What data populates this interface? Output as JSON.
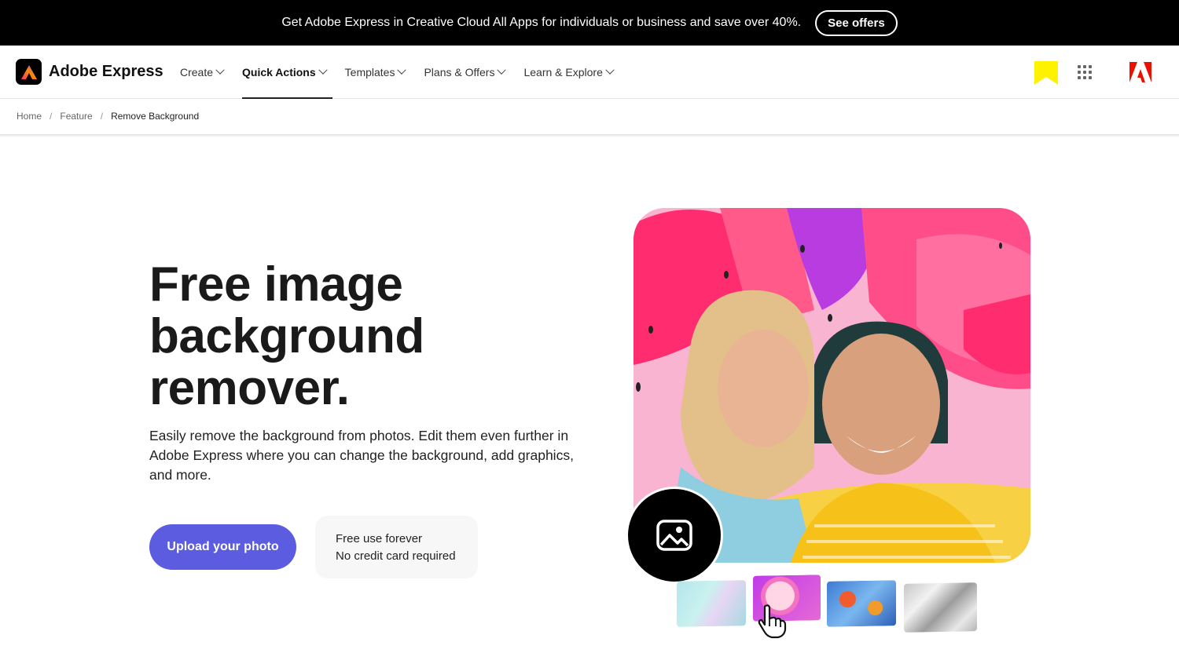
{
  "promo": {
    "text": "Get Adobe Express in Creative Cloud All Apps for individuals or business and save over 40%.",
    "button": "See offers"
  },
  "brand": {
    "name": "Adobe Express"
  },
  "nav": {
    "items": [
      {
        "label": "Create",
        "active": false
      },
      {
        "label": "Quick Actions",
        "active": true
      },
      {
        "label": "Templates",
        "active": false
      },
      {
        "label": "Plans & Offers",
        "active": false
      },
      {
        "label": "Learn & Explore",
        "active": false
      }
    ]
  },
  "icons": {
    "bookmark": "bookmark-icon",
    "apps": "apps-grid-icon",
    "adobe": "adobe-logo-icon",
    "image": "image-icon",
    "cursor": "hand-pointer-icon"
  },
  "breadcrumb": {
    "home": "Home",
    "sep": "/",
    "feature": "Feature",
    "current": "Remove Background"
  },
  "hero": {
    "title": "Free image background remover.",
    "description": "Easily remove the background from photos. Edit them even further in Adobe Express where you can change the background, add graphics, and more.",
    "upload_button": "Upload your photo",
    "free_line1": "Free use forever",
    "free_line2": "No credit card required"
  },
  "colors": {
    "accent": "#5c5ce0",
    "bookmark": "#fff200",
    "adobe_red": "#eb1000"
  }
}
